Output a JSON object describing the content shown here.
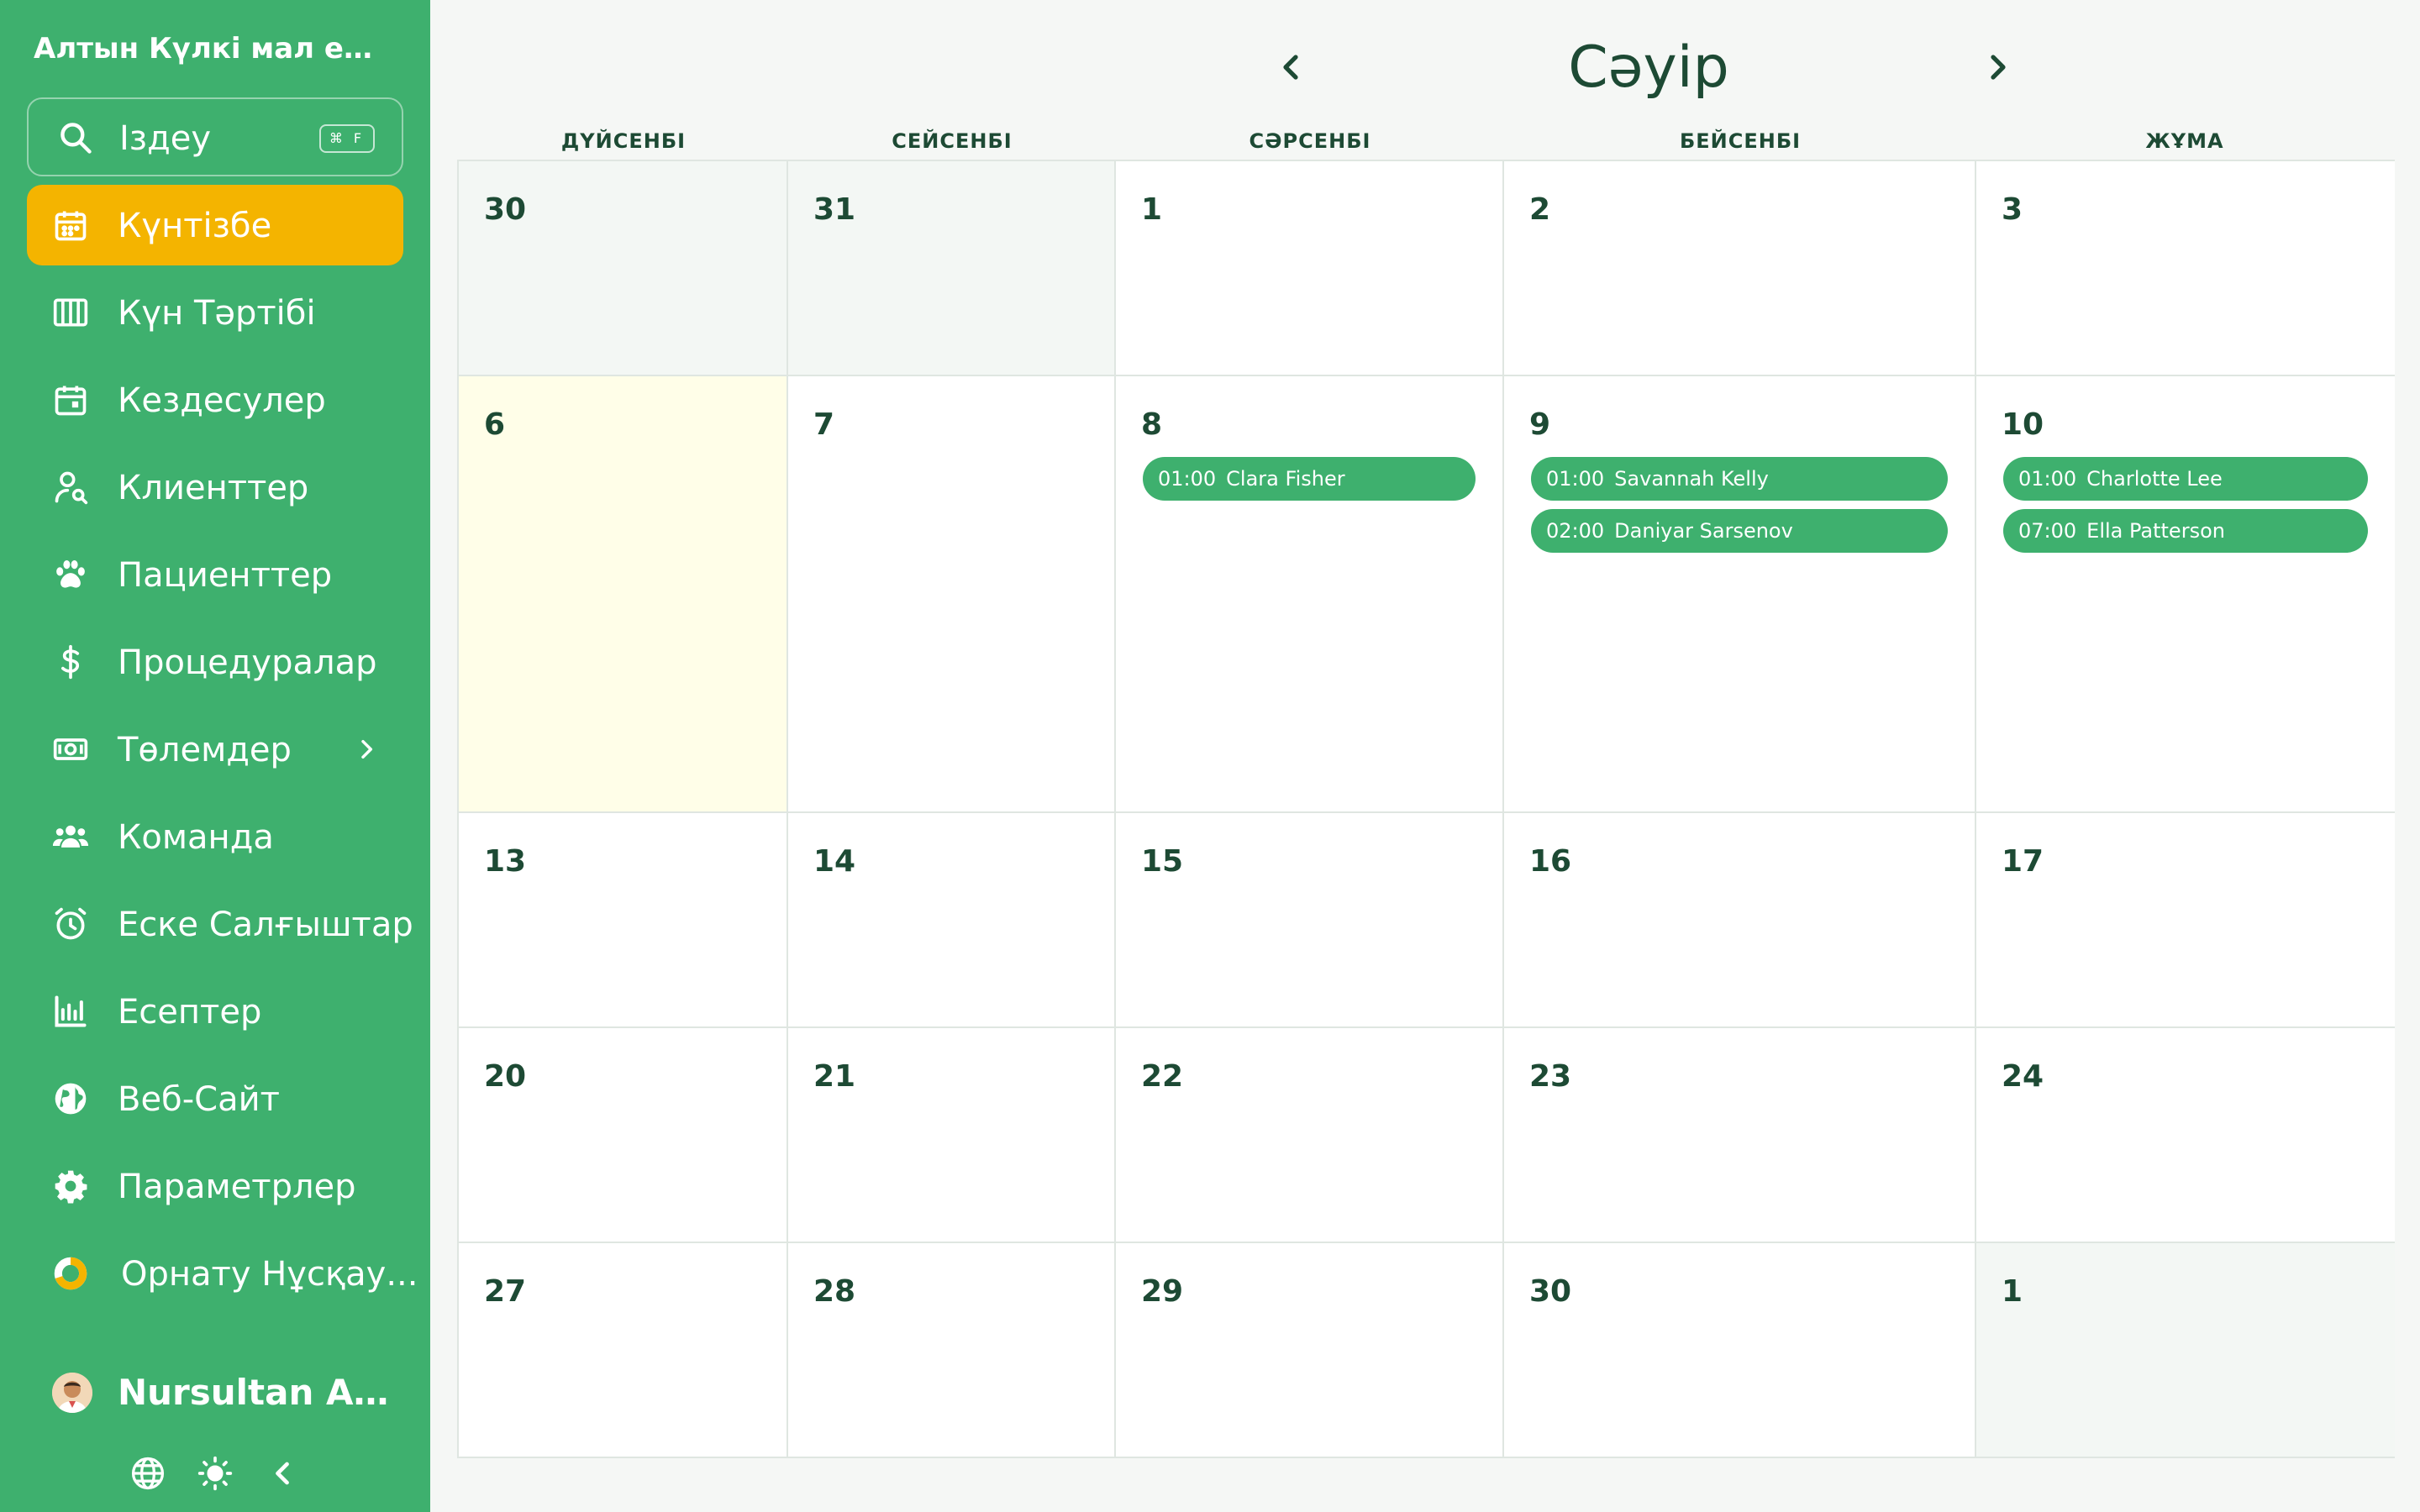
{
  "sidebar": {
    "org_name": "Алтын Күлкі мал ем...",
    "search": {
      "label": "Іздеу",
      "shortcut": "⌘ F"
    },
    "items": [
      {
        "label": "Күнтізбе",
        "icon": "calendar-icon",
        "active": true
      },
      {
        "label": "Күн Тәртібі",
        "icon": "columns-icon"
      },
      {
        "label": "Кездесулер",
        "icon": "calendar-check-icon"
      },
      {
        "label": "Клиенттер",
        "icon": "user-search-icon"
      },
      {
        "label": "Пациенттер",
        "icon": "paw-icon"
      },
      {
        "label": "Процедуралар",
        "icon": "dollar-icon"
      },
      {
        "label": "Төлемдер",
        "icon": "banknote-icon",
        "has_submenu": true
      },
      {
        "label": "Команда",
        "icon": "users-icon"
      },
      {
        "label": "Еске Салғыштар",
        "icon": "alarm-icon"
      },
      {
        "label": "Есептер",
        "icon": "bar-chart-icon"
      },
      {
        "label": "Веб-Сайт",
        "icon": "globe-icon"
      },
      {
        "label": "Параметрлер",
        "icon": "gear-icon"
      },
      {
        "label": "Орнату Нұсқау...",
        "icon": "progress-ring-icon"
      }
    ],
    "user": {
      "name": "Nursultan Akh..."
    },
    "bottom_icons": [
      "globe-icon",
      "sun-icon",
      "chevron-left-icon"
    ]
  },
  "calendar": {
    "month": "Сәуір",
    "weekdays": [
      "ДҮЙСЕНБІ",
      "СЕЙСЕНБІ",
      "СӘРСЕНБІ",
      "БЕЙСЕНБІ",
      "ЖҰМА"
    ],
    "weeks": [
      [
        {
          "day": "30",
          "other": true
        },
        {
          "day": "31",
          "other": true
        },
        {
          "day": "1"
        },
        {
          "day": "2"
        },
        {
          "day": "3"
        }
      ],
      [
        {
          "day": "6",
          "today": true
        },
        {
          "day": "7"
        },
        {
          "day": "8",
          "events": [
            {
              "time": "01:00",
              "title": "Clara Fisher"
            }
          ]
        },
        {
          "day": "9",
          "events": [
            {
              "time": "01:00",
              "title": "Savannah Kelly"
            },
            {
              "time": "02:00",
              "title": "Daniyar Sarsenov"
            }
          ]
        },
        {
          "day": "10",
          "events": [
            {
              "time": "01:00",
              "title": "Charlotte Lee"
            },
            {
              "time": "07:00",
              "title": "Ella Patterson"
            }
          ]
        }
      ],
      [
        {
          "day": "13"
        },
        {
          "day": "14"
        },
        {
          "day": "15"
        },
        {
          "day": "16"
        },
        {
          "day": "17"
        }
      ],
      [
        {
          "day": "20"
        },
        {
          "day": "21"
        },
        {
          "day": "22"
        },
        {
          "day": "23"
        },
        {
          "day": "24"
        }
      ],
      [
        {
          "day": "27"
        },
        {
          "day": "28"
        },
        {
          "day": "29"
        },
        {
          "day": "30"
        },
        {
          "day": "1",
          "other": true
        }
      ]
    ]
  },
  "colors": {
    "sidebar_bg": "#3eb06e",
    "active_item": "#f4b400",
    "text_dark": "#1d4a34",
    "event_bg": "#3eb06e",
    "today_bg": "#fffee8"
  }
}
